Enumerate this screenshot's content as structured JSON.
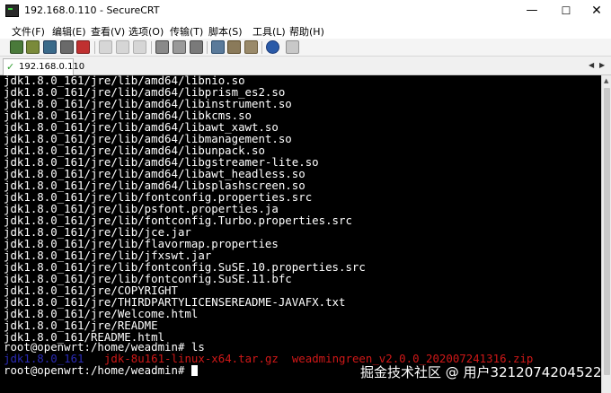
{
  "window": {
    "title": "192.168.0.110 - SecureCRT",
    "minimize_glyph": "—",
    "maximize_glyph": "☐",
    "close_glyph": "✕"
  },
  "menu": {
    "items": [
      "文件(F)",
      "编辑(E)",
      "查看(V)",
      "选项(O)",
      "传输(T)",
      "脚本(S)",
      "工具(L)",
      "帮助(H)"
    ]
  },
  "toolbar": {
    "icons": [
      "connect-icon",
      "quick-connect-icon",
      "connect-tab-icon",
      "reconnect-icon",
      "disconnect-icon",
      "copy-icon",
      "paste-icon",
      "find-icon",
      "print-icon",
      "print-setup-icon",
      "log-icon",
      "session-options-icon",
      "keymap-icon",
      "sftp-icon",
      "help-icon",
      "about-icon"
    ]
  },
  "tab": {
    "check_glyph": "✓",
    "label": "192.168.0.110",
    "nav_left": "◀",
    "nav_right": "▶"
  },
  "terminal": {
    "lines": [
      "jdk1.8.0_161/jre/lib/amd64/libnio.so",
      "jdk1.8.0_161/jre/lib/amd64/libprism_es2.so",
      "jdk1.8.0_161/jre/lib/amd64/libinstrument.so",
      "jdk1.8.0_161/jre/lib/amd64/libkcms.so",
      "jdk1.8.0_161/jre/lib/amd64/libawt_xawt.so",
      "jdk1.8.0_161/jre/lib/amd64/libmanagement.so",
      "jdk1.8.0_161/jre/lib/amd64/libunpack.so",
      "jdk1.8.0_161/jre/lib/amd64/libgstreamer-lite.so",
      "jdk1.8.0_161/jre/lib/amd64/libawt_headless.so",
      "jdk1.8.0_161/jre/lib/amd64/libsplashscreen.so",
      "jdk1.8.0_161/jre/lib/fontconfig.properties.src",
      "jdk1.8.0_161/jre/lib/psfont.properties.ja",
      "jdk1.8.0_161/jre/lib/fontconfig.Turbo.properties.src",
      "jdk1.8.0_161/jre/lib/jce.jar",
      "jdk1.8.0_161/jre/lib/flavormap.properties",
      "jdk1.8.0_161/jre/lib/jfxswt.jar",
      "jdk1.8.0_161/jre/lib/fontconfig.SuSE.10.properties.src",
      "jdk1.8.0_161/jre/lib/fontconfig.SuSE.11.bfc",
      "jdk1.8.0_161/jre/COPYRIGHT",
      "jdk1.8.0_161/jre/THIRDPARTYLICENSEREADME-JAVAFX.txt",
      "jdk1.8.0_161/jre/Welcome.html",
      "jdk1.8.0_161/jre/README",
      "jdk1.8.0_161/README.html"
    ],
    "prompt_ls": "root@openwrt:/home/weadmin# ls",
    "ls_output": {
      "dir": "jdk1.8.0_161",
      "tar": "jdk-8u161-linux-x64.tar.gz",
      "zip": "weadmingreen_v2.0.0_202007241316.zip"
    },
    "prompt_final": "root@openwrt:/home/weadmin# ",
    "dir_color": "#2a2ab5",
    "archive_color": "#d01818"
  },
  "watermark": "掘金技术社区 @ 用户3212074204522"
}
